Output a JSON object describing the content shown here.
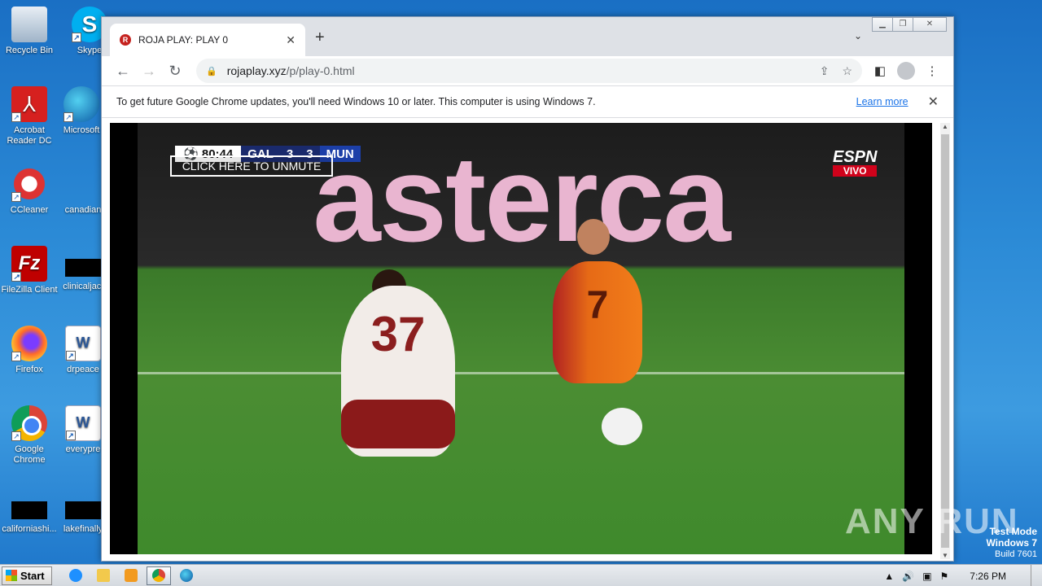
{
  "desktop": {
    "icons": [
      {
        "label": "Recycle Bin",
        "icon": "recycle-bin-icon"
      },
      {
        "label": "Skype",
        "icon": "skype-icon"
      },
      {
        "label": "Acrobat Reader DC",
        "icon": "acrobat-icon"
      },
      {
        "label": "Microsoft",
        "icon": "edge-icon"
      },
      {
        "label": "CCleaner",
        "icon": "ccleaner-icon"
      },
      {
        "label": "canadian",
        "icon": "file-icon"
      },
      {
        "label": "FileZilla Client",
        "icon": "filezilla-icon"
      },
      {
        "label": "clinicaljacl",
        "icon": "file-icon"
      },
      {
        "label": "Firefox",
        "icon": "firefox-icon"
      },
      {
        "label": "drpeace",
        "icon": "word-doc-icon"
      },
      {
        "label": "Google Chrome",
        "icon": "chrome-icon"
      },
      {
        "label": "everypre",
        "icon": "word-doc-icon"
      },
      {
        "label": "californiashi...",
        "icon": "file-icon"
      },
      {
        "label": "lakefinally",
        "icon": "file-icon"
      }
    ]
  },
  "browser": {
    "tab_title": "ROJA PLAY: PLAY 0",
    "new_tab": "+",
    "url_host": "rojaplay.xyz",
    "url_path": "/p/play-0.html",
    "infobar_message": "To get future Google Chrome updates, you'll need Windows 10 or later. This computer is using Windows 7.",
    "infobar_link": "Learn more"
  },
  "video": {
    "scorebug": {
      "time": "80:44",
      "home": "GAL",
      "home_score": "3",
      "away_score": "3",
      "away": "MUN"
    },
    "unmute_label": "CLICK HERE TO UNMUTE",
    "broadcaster": "ESPN",
    "live_label": "VIVO",
    "ad_text": "asterca",
    "white_number": "37",
    "orange_number": "7"
  },
  "watermark": {
    "brand": "ANY RUN",
    "testmode_line1": "Test Mode",
    "testmode_line2": "Windows 7",
    "testmode_build": "Build 7601"
  },
  "taskbar": {
    "start_label": "Start",
    "clock": "7:26 PM"
  }
}
